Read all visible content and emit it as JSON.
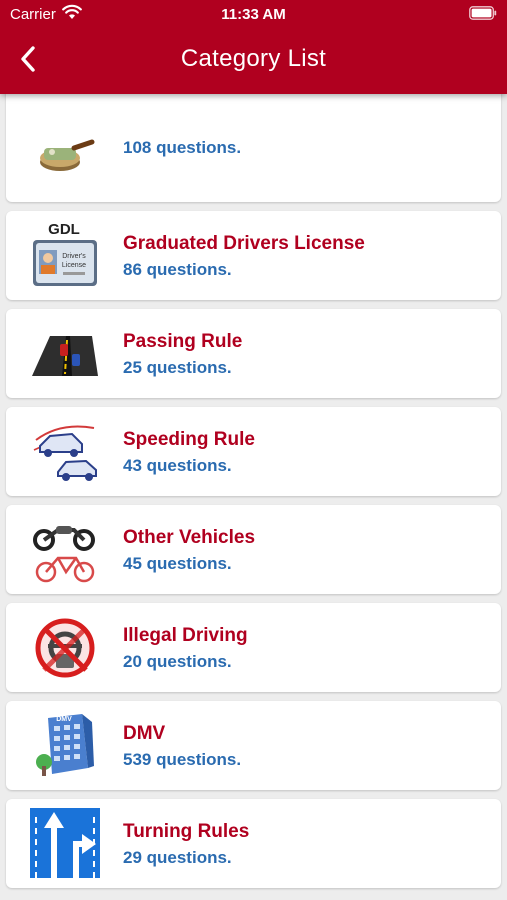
{
  "status_bar": {
    "carrier": "Carrier",
    "time": "11:33 AM"
  },
  "nav": {
    "title": "Category List",
    "back_icon": "chevron-left-icon"
  },
  "categories": [
    {
      "title": "",
      "count": "108 questions.",
      "icon": "money-icon"
    },
    {
      "title": "Graduated Drivers License",
      "count": "86 questions.",
      "icon": "gdl-license-icon",
      "icon_text": "GDL"
    },
    {
      "title": "Passing Rule",
      "count": "25 questions.",
      "icon": "road-passing-icon"
    },
    {
      "title": "Speeding Rule",
      "count": "43 questions.",
      "icon": "speeding-cars-icon"
    },
    {
      "title": "Other Vehicles",
      "count": "45 questions.",
      "icon": "motorcycle-bicycle-icon"
    },
    {
      "title": "Illegal Driving",
      "count": "20 questions.",
      "icon": "no-driving-icon"
    },
    {
      "title": "DMV",
      "count": "539 questions.",
      "icon": "dmv-building-icon"
    },
    {
      "title": "Turning Rules",
      "count": "29 questions.",
      "icon": "turn-arrow-icon"
    }
  ],
  "colors": {
    "accent": "#b0001f",
    "count": "#2a6bb0",
    "background": "#ededed"
  }
}
